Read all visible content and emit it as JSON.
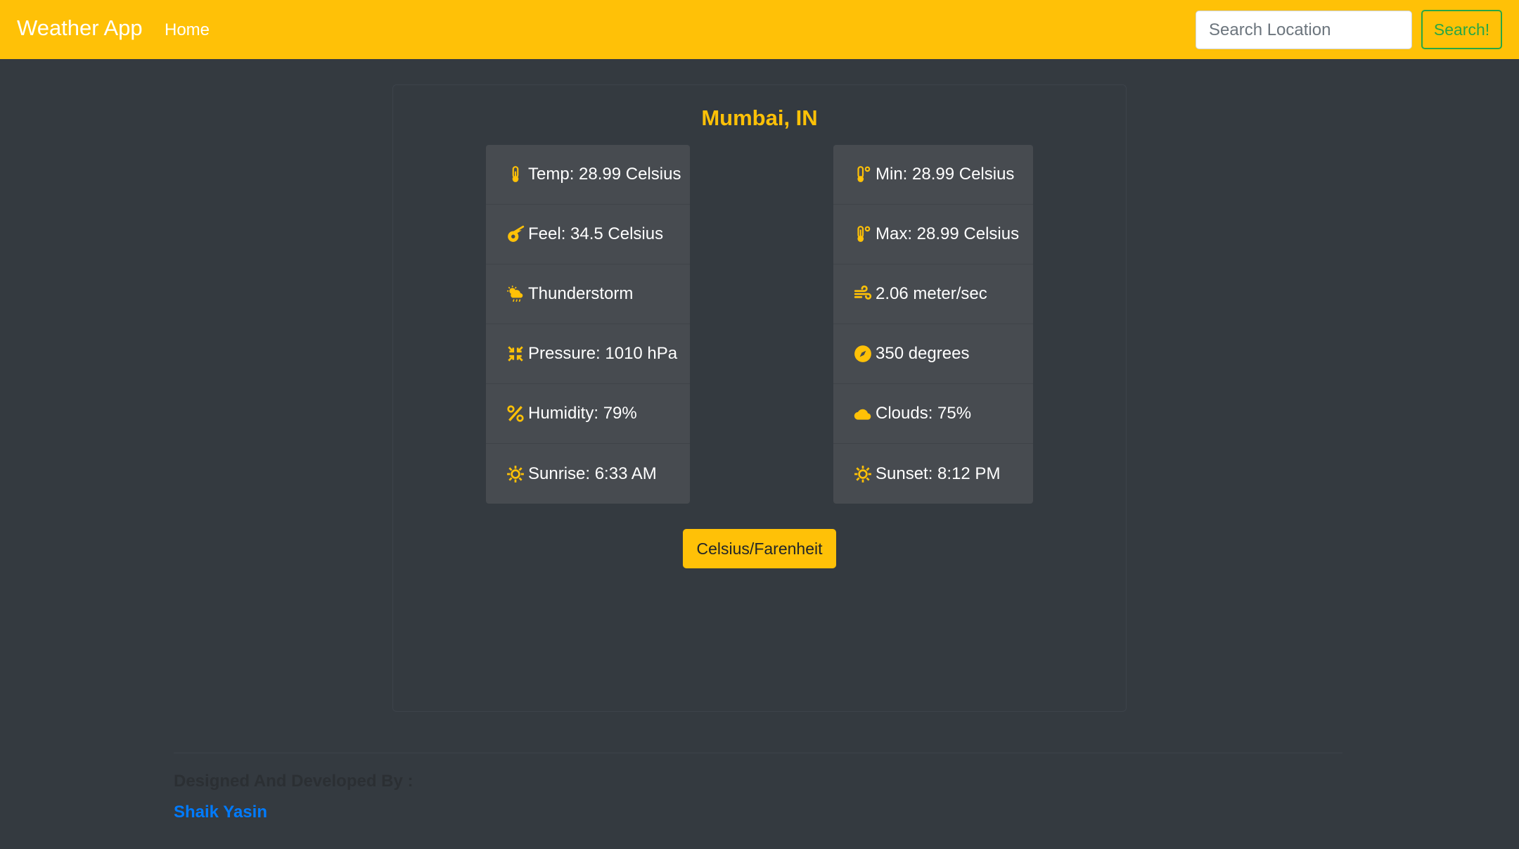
{
  "navbar": {
    "brand": "Weather App",
    "home_link": "Home",
    "search_placeholder": "Search Location",
    "search_button": "Search!",
    "background_color": "#ffc107"
  },
  "weather": {
    "city": "Mumbai, IN",
    "left_column": [
      {
        "icon": "thermometer-icon",
        "text": "Temp: 28.99 Celsius"
      },
      {
        "icon": "meteor-icon",
        "text": "Feel: 34.5 Celsius"
      },
      {
        "icon": "cloud-sun-rain-icon",
        "text": "Thunderstorm"
      },
      {
        "icon": "compress-icon",
        "text": "Pressure: 1010 hPa"
      },
      {
        "icon": "percent-icon",
        "text": "Humidity: 79%"
      },
      {
        "icon": "sun-icon",
        "text": "Sunrise: 6:33 AM"
      }
    ],
    "right_column": [
      {
        "icon": "temperature-low-icon",
        "text": "Min: 28.99 Celsius"
      },
      {
        "icon": "temperature-high-icon",
        "text": "Max: 28.99 Celsius"
      },
      {
        "icon": "wind-icon",
        "text": "2.06 meter/sec"
      },
      {
        "icon": "compass-icon",
        "text": "350 degrees"
      },
      {
        "icon": "cloud-icon",
        "text": "Clouds: 75%"
      },
      {
        "icon": "sun-icon",
        "text": "Sunset: 8:12 PM"
      }
    ],
    "toggle_button": "Celsius/Farenheit",
    "accent_color": "#ffc107",
    "card_color": "#474b50"
  },
  "footer": {
    "label": "Designed And Developed By :",
    "author": "Shaik Yasin",
    "author_color": "#007bff"
  },
  "page": {
    "background_color": "#343a40"
  }
}
